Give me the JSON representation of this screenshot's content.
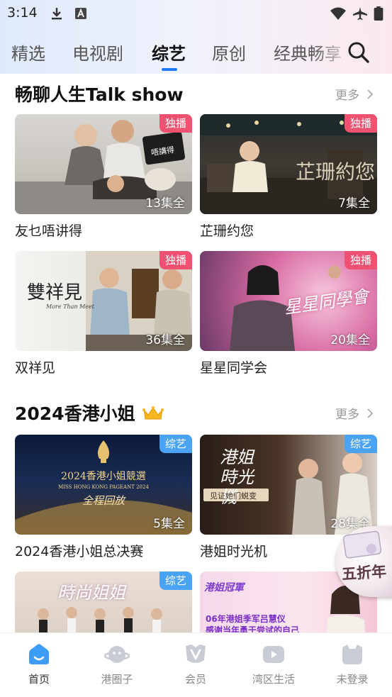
{
  "status_bar": {
    "time": "3:14"
  },
  "tabs": [
    {
      "label": "精选",
      "active": false
    },
    {
      "label": "电视剧",
      "active": false
    },
    {
      "label": "综艺",
      "active": true
    },
    {
      "label": "原创",
      "active": false
    },
    {
      "label": "经典畅享",
      "active": false
    }
  ],
  "sections": [
    {
      "title": "畅聊人生Talk show",
      "more": "更多",
      "items": [
        {
          "title": "友乜唔讲得",
          "badge": "独播",
          "episodes": "13集全",
          "art_text": "唔講得"
        },
        {
          "title": "芷珊约您",
          "badge": "独播",
          "episodes": "7集全",
          "art_text": "芷珊約您"
        },
        {
          "title": "双祥见",
          "badge": "独播",
          "episodes": "36集全",
          "art_text": "雙祥見",
          "art_sub": "More Than Meet"
        },
        {
          "title": "星星同学会",
          "badge": "独播",
          "episodes": "20集全",
          "art_text": "星星同學會"
        }
      ]
    },
    {
      "title": "2024香港小姐",
      "more": "更多",
      "items": [
        {
          "title": "2024香港小姐总决赛",
          "badge": "综艺",
          "episodes": "5集全",
          "art_text": "2024香港小姐競選",
          "art_sub": "MISS HONG KONG PAGEANT 2024",
          "art_sub2": "全程回放"
        },
        {
          "title": "港姐时光机",
          "badge": "综艺",
          "episodes": "28集全",
          "art_text": "港姐時光機",
          "art_sub": "见证她们蜕变"
        },
        {
          "title": "",
          "badge": "综艺",
          "episodes": "",
          "art_text": "時尚姐姐"
        },
        {
          "title": "",
          "badge": "",
          "episodes": "",
          "art_text": "港姐冠軍",
          "art_sub": "06年港姐季军吕慧仪",
          "art_sub2": "感谢当年勇于尝试的自己"
        }
      ]
    }
  ],
  "float_promo": {
    "label": "五折年"
  },
  "bottom_nav": [
    {
      "label": "首页",
      "icon": "home-icon",
      "active": true
    },
    {
      "label": "港圈子",
      "icon": "planet-icon",
      "active": false
    },
    {
      "label": "会员",
      "icon": "vip-icon",
      "active": false
    },
    {
      "label": "湾区生活",
      "icon": "video-icon",
      "active": false
    },
    {
      "label": "未登录",
      "icon": "user-icon",
      "active": false
    }
  ],
  "colors": {
    "accent": "#1e7cf0",
    "exclusive_badge": "#ef5270",
    "variety_badge": "#4aa3f5"
  }
}
